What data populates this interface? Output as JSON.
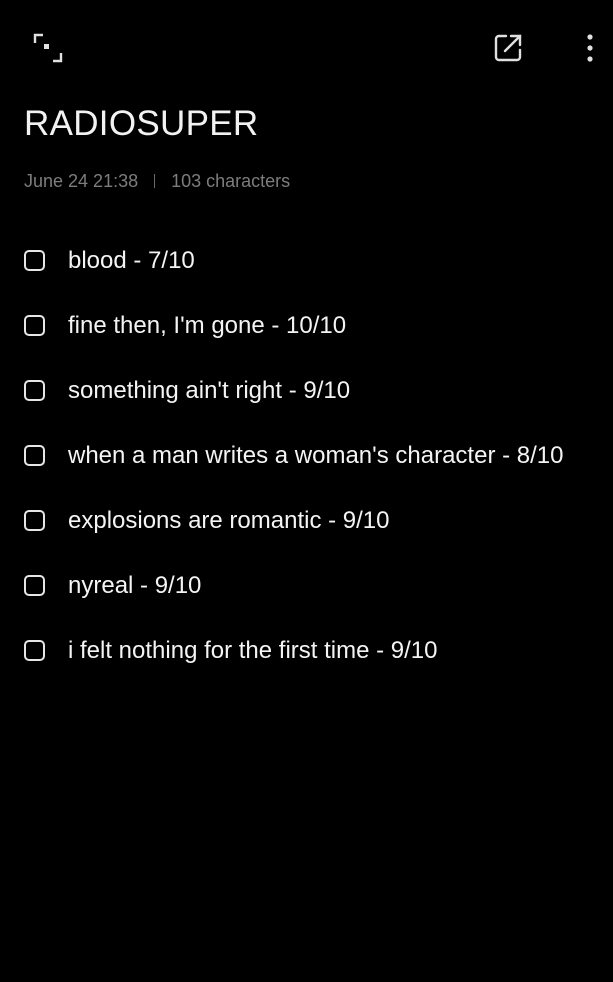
{
  "toolbar": {
    "focus_icon": "focus-frame-icon",
    "share_icon": "share-external-icon",
    "more_icon": "more-vertical-icon"
  },
  "note": {
    "title": "RADIOSUPER",
    "date": "June 24  21:38",
    "character_count": "103 characters",
    "items": [
      {
        "text": "blood - 7/10",
        "checked": false
      },
      {
        "text": "fine then, I'm gone - 10/10",
        "checked": false
      },
      {
        "text": "something ain't right - 9/10",
        "checked": false
      },
      {
        "text": "when a man writes a woman's character - 8/10",
        "checked": false
      },
      {
        "text": "explosions are romantic - 9/10",
        "checked": false
      },
      {
        "text": "nyreal - 9/10",
        "checked": false
      },
      {
        "text": "i felt nothing for the first time - 9/10",
        "checked": false
      }
    ]
  },
  "colors": {
    "background": "#000000",
    "text": "#f4f4f4",
    "meta_text": "#7d7d7d",
    "icon": "#e0e0e0"
  }
}
